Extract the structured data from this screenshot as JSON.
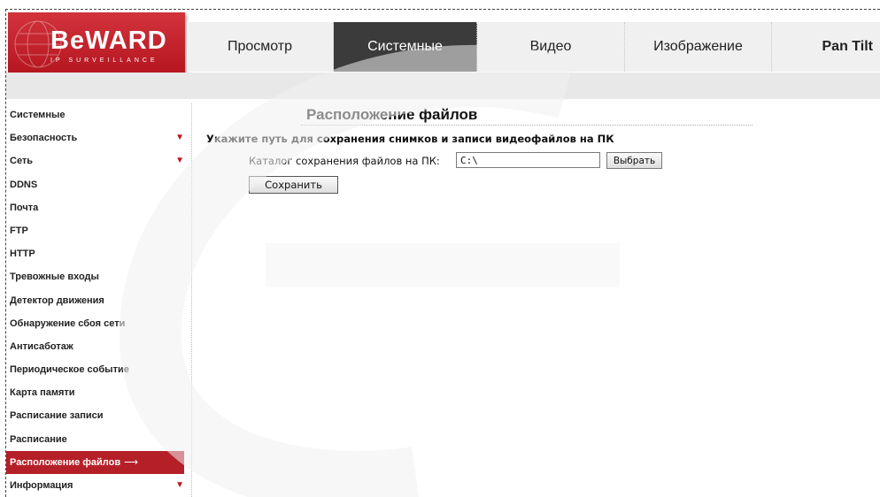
{
  "brand": {
    "logo_text": "BeWARD",
    "logo_subtitle": "IP SURVEILLANCE",
    "color": "#b3141e"
  },
  "nav": {
    "tabs": [
      {
        "label": "Просмотр",
        "active": false
      },
      {
        "label": "Системные",
        "active": true
      },
      {
        "label": "Видео",
        "active": false
      },
      {
        "label": "Изображение",
        "active": false
      },
      {
        "label": "Pan Tilt",
        "active": false
      }
    ]
  },
  "sidebar": {
    "items": [
      {
        "label": "Системные",
        "expandable": false
      },
      {
        "label": "Безопасность",
        "expandable": true
      },
      {
        "label": "Сеть",
        "expandable": true
      },
      {
        "label": "DDNS",
        "expandable": false
      },
      {
        "label": "Почта",
        "expandable": false
      },
      {
        "label": "FTP",
        "expandable": false
      },
      {
        "label": "HTTP",
        "expandable": false
      },
      {
        "label": "Тревожные входы",
        "expandable": false
      },
      {
        "label": "Детектор движения",
        "expandable": false
      },
      {
        "label": "Обнаружение сбоя сети",
        "expandable": false
      },
      {
        "label": "Антисаботаж",
        "expandable": false
      },
      {
        "label": "Периодическое событие",
        "expandable": false
      },
      {
        "label": "Карта памяти",
        "expandable": false
      },
      {
        "label": "Расписание записи",
        "expandable": false
      },
      {
        "label": "Расписание",
        "expandable": false
      },
      {
        "label": "Расположение файлов",
        "expandable": false,
        "active": true
      },
      {
        "label": "Информация",
        "expandable": true
      }
    ],
    "expand_icon": "triangle-down-icon",
    "active_icon": "right-arrow-icon"
  },
  "main": {
    "title": "Расположение файлов",
    "section_heading": "Укажите путь для сохранения снимков и записи видеофайлов на ПК",
    "field_label": "Каталог сохранения файлов на ПК:",
    "path_value": "C:\\",
    "browse_label": "Выбрать",
    "save_label": "Сохранить"
  },
  "colors": {
    "accent": "#b52028",
    "nav_active_bg": "#3b3b3b",
    "nav_bg": "#f0f0f0"
  }
}
